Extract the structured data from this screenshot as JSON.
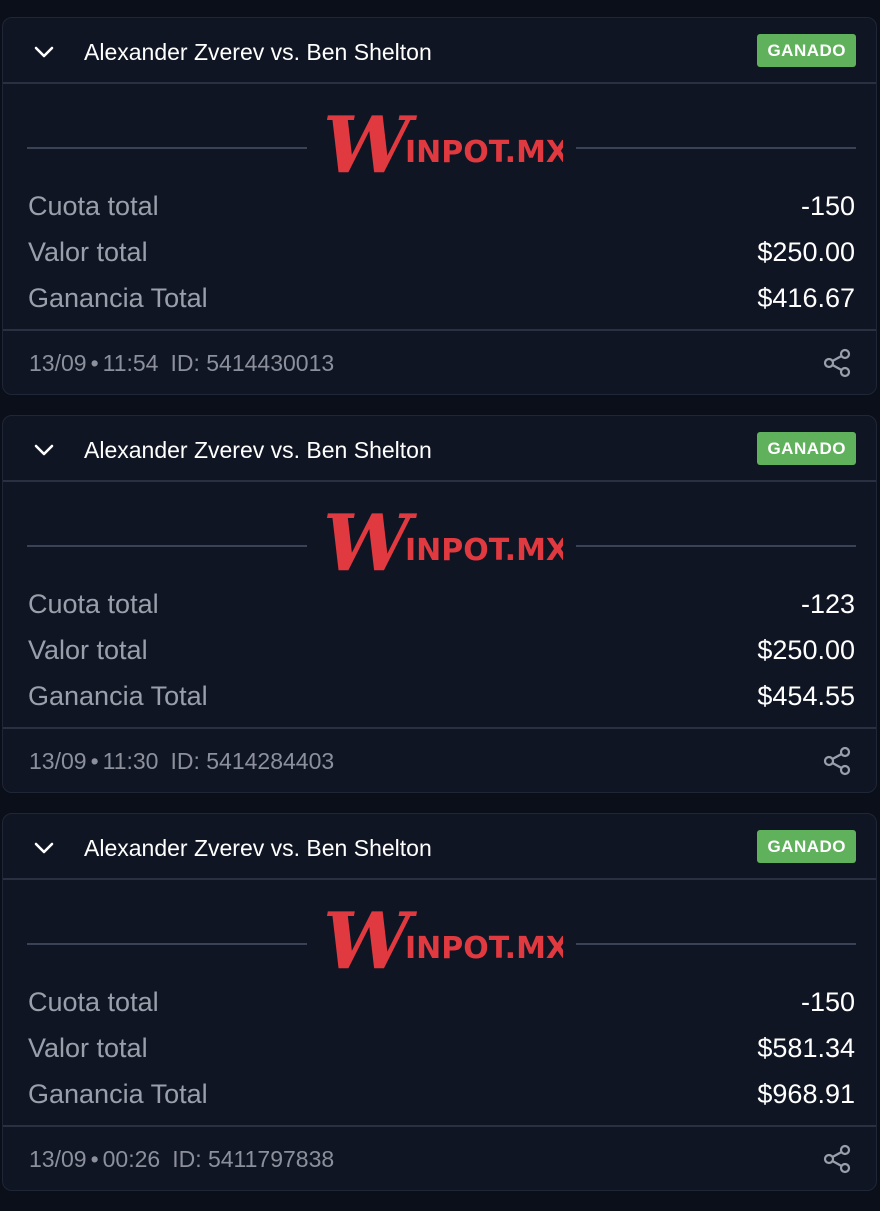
{
  "bets": [
    {
      "title": "Alexander Zverev vs. Ben Shelton",
      "status": "GANADO",
      "brand": {
        "script_letter": "W",
        "name": "INPOT.MX"
      },
      "rows": [
        {
          "label": "Cuota total",
          "value": "-150"
        },
        {
          "label": "Valor total",
          "value": "$250.00"
        },
        {
          "label": "Ganancia Total",
          "value": "$416.67"
        }
      ],
      "date": "13/09",
      "separator": "•",
      "time": "11:54",
      "id_label": "ID:",
      "id": "5414430013",
      "expand_icon": "chevron-down-icon",
      "share_icon": "share-icon"
    },
    {
      "title": "Alexander Zverev vs. Ben Shelton",
      "status": "GANADO",
      "brand": {
        "script_letter": "W",
        "name": "INPOT.MX"
      },
      "rows": [
        {
          "label": "Cuota total",
          "value": "-123"
        },
        {
          "label": "Valor total",
          "value": "$250.00"
        },
        {
          "label": "Ganancia Total",
          "value": "$454.55"
        }
      ],
      "date": "13/09",
      "separator": "•",
      "time": "11:30",
      "id_label": "ID:",
      "id": "5414284403",
      "expand_icon": "chevron-down-icon",
      "share_icon": "share-icon"
    },
    {
      "title": "Alexander Zverev vs. Ben Shelton",
      "status": "GANADO",
      "brand": {
        "script_letter": "W",
        "name": "INPOT.MX"
      },
      "rows": [
        {
          "label": "Cuota total",
          "value": "-150"
        },
        {
          "label": "Valor total",
          "value": "$581.34"
        },
        {
          "label": "Ganancia Total",
          "value": "$968.91"
        }
      ],
      "date": "13/09",
      "separator": "•",
      "time": "00:26",
      "id_label": "ID:",
      "id": "5411797838",
      "expand_icon": "chevron-down-icon",
      "share_icon": "share-icon"
    }
  ],
  "colors": {
    "background": "#0b0f1a",
    "card": "#101524",
    "status_green": "#5fb25b",
    "brand_red": "#e0393f",
    "label_gray": "#9aa0ab"
  }
}
